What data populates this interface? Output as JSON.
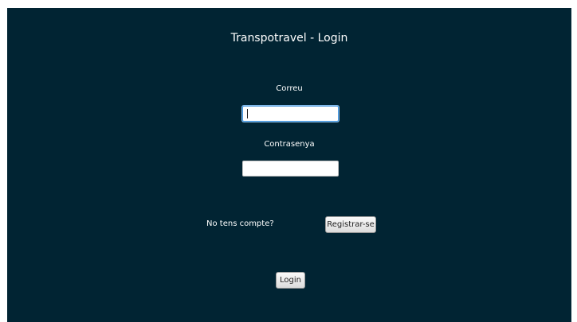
{
  "window": {
    "title": "Transpotravel - Login"
  },
  "form": {
    "email_label": "Correu",
    "email_value": "",
    "password_label": "Contrasenya",
    "password_value": "",
    "no_account_text": "No tens compte?",
    "register_button": "Registrar-se",
    "login_button": "Login"
  },
  "colors": {
    "background": "#012433",
    "text": "#ffffff",
    "focus": "#3b8ed7"
  }
}
